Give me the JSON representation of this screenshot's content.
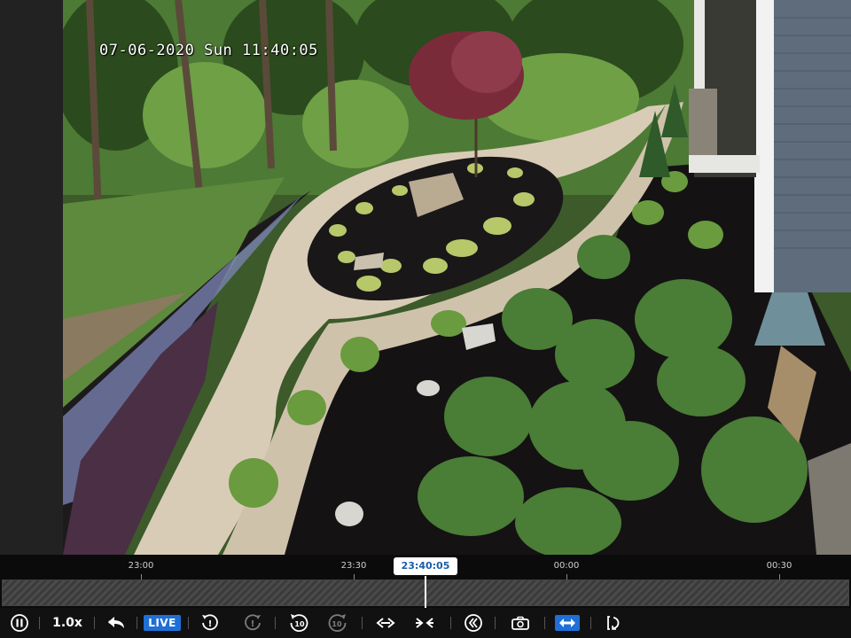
{
  "camera": {
    "osd_timestamp": "07-06-2020 Sun 11:40:05"
  },
  "timeline": {
    "current_time": "23:40:05",
    "ticks": [
      "23:00",
      "23:30",
      "00:00",
      "00:30"
    ]
  },
  "controls": {
    "speed": "1.0x",
    "live_label": "LIVE",
    "skip_back_seconds": "10",
    "skip_forward_seconds": "10"
  },
  "colors": {
    "accent": "#1f6fd6",
    "playhead_text": "#1a5fa8"
  }
}
